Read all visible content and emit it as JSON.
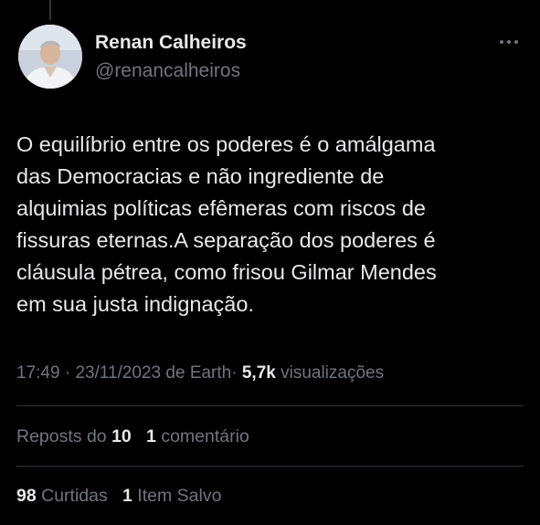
{
  "tweet": {
    "author": {
      "name": "Renan Calheiros",
      "handle": "@renancalheiros"
    },
    "text_lines": [
      "O equilíbrio entre os poderes é o amálgama",
      "das Democracias e não ingrediente de",
      "alquimias políticas efêmeras com riscos de",
      "fissuras eternas.A separação dos poderes é",
      "cláusula pétrea, como frisou Gilmar Mendes",
      "em sua justa indignação."
    ],
    "meta": {
      "time": "17:49",
      "separator": "·",
      "date": "23/11/2023",
      "source": "de Earth",
      "views_count": "5,7k",
      "views_label": "visualizações"
    },
    "engagement": {
      "reposts_label": "Reposts do",
      "reposts_count": "10",
      "comments_count": "1",
      "comments_label": "comentário",
      "likes_count": "98",
      "likes_label": "Curtidas",
      "saves_count": "1",
      "saves_label": "Item Salvo"
    }
  },
  "icons": {
    "more": "more-horizontal-icon"
  },
  "colors": {
    "background": "#000000",
    "primary_text": "#e7e9ea",
    "secondary_text": "#71767b",
    "divider": "#2f3336"
  }
}
